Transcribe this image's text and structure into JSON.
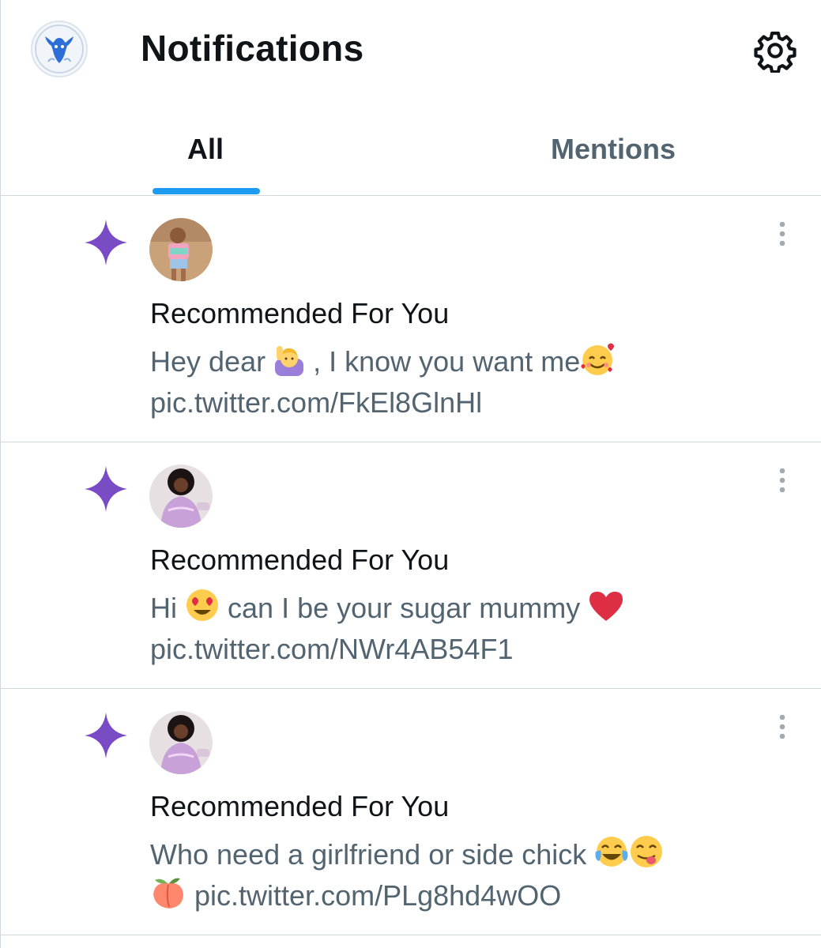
{
  "header": {
    "title": "Notifications",
    "avatar_icon": "goat-logo-icon",
    "settings_icon": "gear-icon"
  },
  "tabs": [
    {
      "label": "All",
      "active": true
    },
    {
      "label": "Mentions",
      "active": false
    }
  ],
  "colors": {
    "accent": "#1d9bf0",
    "sparkle": "#794bc4",
    "secondary_text": "#536471",
    "divider": "#cfd9de"
  },
  "notifications": [
    {
      "icon": "sparkle-icon",
      "heading": "Recommended For You",
      "text_1": "Hey dear",
      "text_2": ", I know you want me",
      "link": "pic.twitter.com/FkEl8GlnHl",
      "emojis": [
        "woman-raising-hand",
        "smiling-face-with-hearts"
      ]
    },
    {
      "icon": "sparkle-icon",
      "heading": "Recommended For You",
      "text_1": "Hi",
      "text_2": "can I be your sugar mummy",
      "link": "pic.twitter.com/NWr4AB54F1",
      "emojis": [
        "heart-eyes",
        "red-heart"
      ]
    },
    {
      "icon": "sparkle-icon",
      "heading": "Recommended For You",
      "text_1": "Who need a girlfriend or side chick",
      "text_2": "",
      "link": "pic.twitter.com/PLg8hd4wOO",
      "emojis": [
        "tears-of-joy",
        "face-savoring-food",
        "peach"
      ]
    }
  ]
}
